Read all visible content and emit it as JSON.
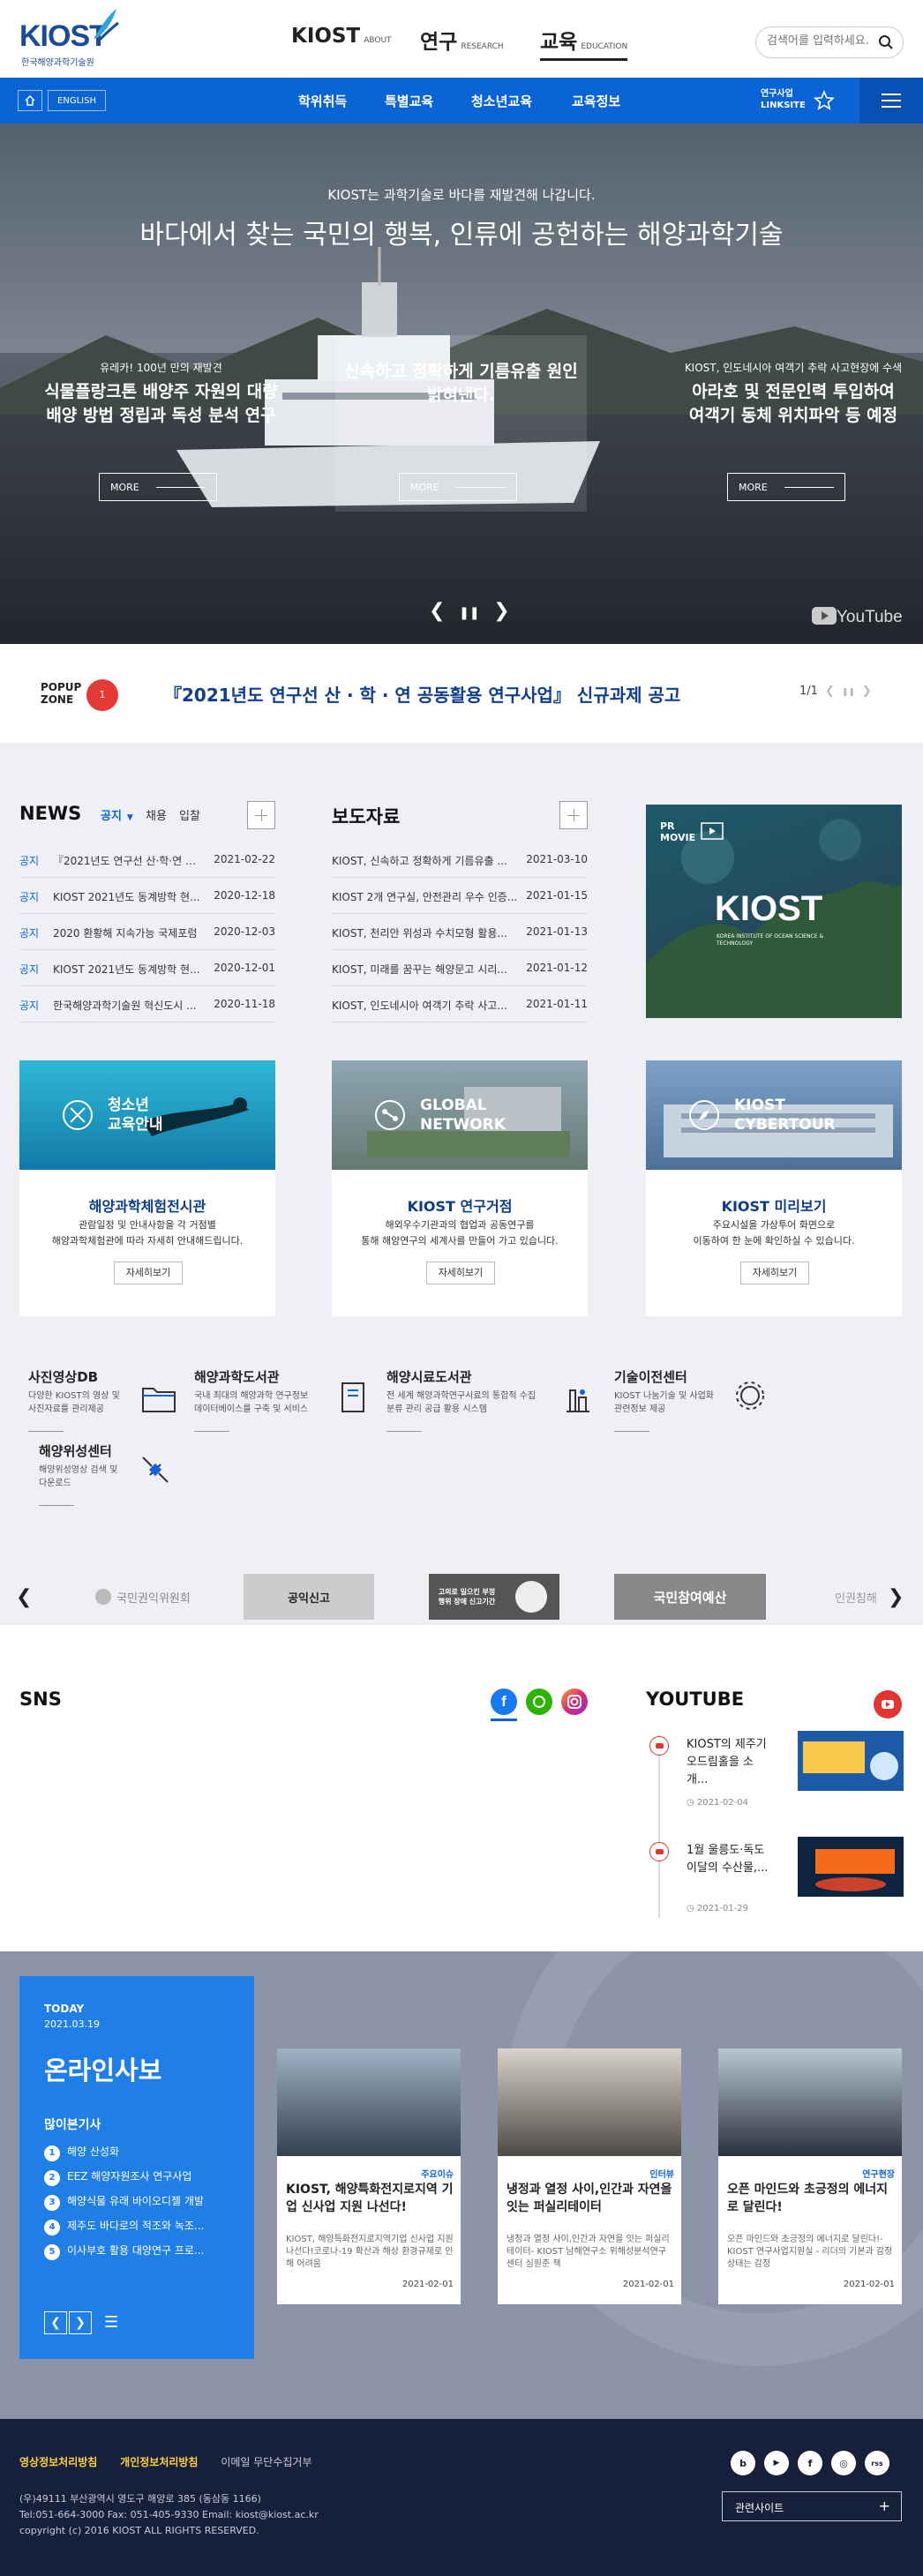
{
  "header": {
    "logo_text": "KIOST",
    "logo_sub": "한국해양과학기술원",
    "nav": [
      {
        "label": "KIOST",
        "en": "ABOUT"
      },
      {
        "label": "연구",
        "en": "RESEARCH"
      },
      {
        "label": "교육",
        "en": "EDUCATION"
      }
    ],
    "search_placeholder": "검색어를 입력하세요."
  },
  "bluebar": {
    "english": "ENGLISH",
    "menu": [
      "학위취득",
      "특별교육",
      "청소년교육",
      "교육정보"
    ],
    "linksite_line1": "연구사업",
    "linksite_line2": "LINKSITE"
  },
  "hero": {
    "subtitle": "KIOST는 과학기술로 바다를 재발견해 나갑니다.",
    "title": "바다에서 찾는 국민의 행복, 인류에 공헌하는 해양과학기술",
    "cards": [
      {
        "kicker": "유레카! 100년 만의 재발견",
        "line1": "식물플랑크톤 배양주 자원의 대량",
        "line2": "배양 방법 정립과 독성 분석 연구",
        "more": "MORE"
      },
      {
        "kicker": "",
        "line1": "신속하고 정확하게 기름유출 원인",
        "line2": "밝혀낸다.",
        "more": "MORE"
      },
      {
        "kicker": "KIOST, 인도네시아 여객기 추락 사고현장에 수색",
        "line1": "아라호 및 전문인력 투입하여",
        "line2": "여객기 동체 위치파악 등 예정",
        "more": "MORE"
      }
    ],
    "youtube": "YouTube"
  },
  "popup": {
    "label1": "POPUP",
    "label2": "ZONE",
    "count": "1",
    "text": "『2021년도 연구선 산 · 학 · 연 공동활용 연구사업』 신규과제 공고",
    "page": "1/1"
  },
  "news": {
    "title": "NEWS",
    "tabs": [
      "공지",
      "채용",
      "입찰"
    ],
    "items": [
      {
        "tag": "공지",
        "title": "『2021년도 연구선 산·학·연 공...",
        "date": "2021-02-22"
      },
      {
        "tag": "공지",
        "title": "KIOST 2021년도 동계방학 현...",
        "date": "2020-12-18"
      },
      {
        "tag": "공지",
        "title": "2020 환황해 지속가능 국제포럼",
        "date": "2020-12-03"
      },
      {
        "tag": "공지",
        "title": "KIOST 2021년도 동계방학 현...",
        "date": "2020-12-01"
      },
      {
        "tag": "공지",
        "title": "한국해양과학기술원 혁신도시 ...",
        "date": "2020-11-18"
      }
    ]
  },
  "press": {
    "title": "보도자료",
    "items": [
      {
        "title": "KIOST, 신속하고 정확하게 기름유출 ...",
        "date": "2021-03-10"
      },
      {
        "title": "KIOST 2개 연구실, 안전관리 우수 인증...",
        "date": "2021-01-15"
      },
      {
        "title": "KIOST, 천리안 위성과 수치모형 활용...",
        "date": "2021-01-13"
      },
      {
        "title": "KIOST, 미래를 꿈꾸는 해양문고 시리...",
        "date": "2021-01-12"
      },
      {
        "title": "KIOST, 인도네시아 여객기 추락 사고...",
        "date": "2021-01-11"
      }
    ]
  },
  "prmovie": {
    "label1": "PR",
    "label2": "MOVIE",
    "brand": "KIOST",
    "brand_sub": "KOREA INSTITUTE OF OCEAN SCIENCE & TECHNOLOGY"
  },
  "cards": [
    {
      "overlay1": "청소년",
      "overlay2": "교육안내",
      "title": "해양과학체험전시관",
      "desc1": "관람일정 및 안내사항을 각 거점별",
      "desc2": "해양과학체험관에 따라 자세히 안내해드립니다.",
      "button": "자세히보기"
    },
    {
      "overlay1": "GLOBAL",
      "overlay2": "NETWORK",
      "title": "KIOST 연구거점",
      "desc1": "해외우수기관과의 협업과 공동연구를",
      "desc2": "통해 해양연구의 세계사를 만들어 가고 있습니다.",
      "button": "자세히보기"
    },
    {
      "overlay1": "KIOST",
      "overlay2": "CYBERTOUR",
      "title": "KIOST 미리보기",
      "desc1": "주요시설을 가상투어 화면으로",
      "desc2": "이동하여 한 눈에 확인하실 수 있습니다.",
      "button": "자세히보기"
    }
  ],
  "services": [
    {
      "title": "사진영상DB",
      "d1": "다양한 KIOST의 영상 및",
      "d2": "사진자료를 관리제공"
    },
    {
      "title": "해양과학도서관",
      "d1": "국내 최대의 해양과학 연구정보",
      "d2": "데이터베이스를 구축 및 서비스"
    },
    {
      "title": "해양시료도서관",
      "d1": "전 세계 해양과학연구시료의 통합적 수집",
      "d2": "분류 관리 공급 활용 시스템"
    },
    {
      "title": "기술이전센터",
      "d1": "KIOST 나눔기술 및 사업화",
      "d2": "관련정보 제공"
    },
    {
      "title": "해양위성센터",
      "d1": "해양위성영상 검색 및",
      "d2": "다운로드"
    }
  ],
  "banners": [
    {
      "text": "국민권익위원회"
    },
    {
      "text": "공익신고"
    },
    {
      "text": "고의로 일으킨 부정행위 장애 신고기간"
    },
    {
      "text": "국민참여예산"
    },
    {
      "text": "인권침해"
    }
  ],
  "sns": {
    "title": "SNS"
  },
  "youtube": {
    "title": "YOUTUBE",
    "items": [
      {
        "title": "KIOST의 제주기 오드림홀을 소개...",
        "date": "2021-02-04"
      },
      {
        "title": "1월 울릉도·독도 이달의 수산물,...",
        "date": "2021-01-29"
      }
    ]
  },
  "webzine": {
    "today": "TODAY",
    "date": "2021.03.19",
    "title": "온라인사보",
    "popular": "많이본기사",
    "items": [
      "해양 산성화",
      "EEZ 해양자원조사 연구사업",
      "해양식물 유래 바이오디젤 개발",
      "제주도 바다로의 적조와 녹조...",
      "이사부호 활용 대양연구 프로..."
    ],
    "news": [
      {
        "category": "주요이슈",
        "title": "KIOST, 해양특화전지로지역 기업 신사업 지원 나선다!",
        "body": "KIOST, 해양특화전지로지역기업 신사업 지원 나선다!코로나-19 확산과 해상 환경규제로 인해 어려움",
        "date": "2021-02-01"
      },
      {
        "category": "인터뷰",
        "title": "냉정과 열정 사이,인간과 자연을 잇는 퍼실리테이터",
        "body": "냉정과 열정 사이,인간과 자연을 잇는 퍼실리테이터- KIOST 남해연구소 위해성분석연구센터 심원준 책",
        "date": "2021-02-01"
      },
      {
        "category": "연구현장",
        "title": "오픈 마인드와 초긍정의 에너지로 달린다!",
        "body": "오픈 마인드와 초긍정의 에너지로 달린다!- KIOST 연구사업지원실 - 리더의 기본과 감정 상태는 감정",
        "date": "2021-02-01"
      }
    ]
  },
  "footer": {
    "policy1": "영상정보처리방침",
    "policy2": "개인정보처리방침",
    "policy3": "이메일 무단수집거부",
    "address": "(우)49111 부산광역시 영도구 해양로 385 (동삼동 1166)",
    "contact": "Tel:051-664-3000 Fax: 051-405-9330 Email: kiost@kiost.ac.kr",
    "copyright": "copyright (c) 2016 KIOST ALL RIGHTS RESERVED.",
    "related": "관련사이트",
    "social": [
      "b",
      "▶",
      "f",
      "◎",
      "rss"
    ]
  },
  "colors": {
    "primary": "#0a64d6",
    "navy": "#16203a",
    "accent": "#e3342f",
    "title_blue": "#0a3c8c"
  }
}
